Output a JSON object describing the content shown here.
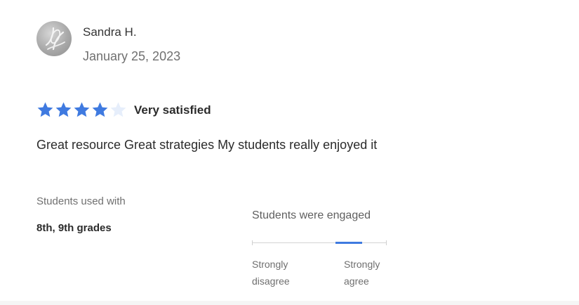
{
  "review": {
    "reviewer": {
      "name": "Sandra H.",
      "avatar_icon": "avatar-leaf-icon"
    },
    "date": "January 25, 2023",
    "rating": {
      "value": 4,
      "max": 5,
      "label": "Very satisfied",
      "filled_color": "#3f7ae0",
      "empty_color": "#e6eefb"
    },
    "text": "Great resource Great strategies My students really enjoyed it",
    "students_used_with": {
      "label": "Students used with",
      "value": "8th, 9th grades"
    },
    "engagement": {
      "label": "Students were engaged",
      "low_label_line1": "Strongly",
      "low_label_line2": "disagree",
      "high_label_line1": "Strongly",
      "high_label_line2": "agree",
      "level": 4,
      "levels": 5,
      "accent_color": "#3f7ae0"
    }
  }
}
